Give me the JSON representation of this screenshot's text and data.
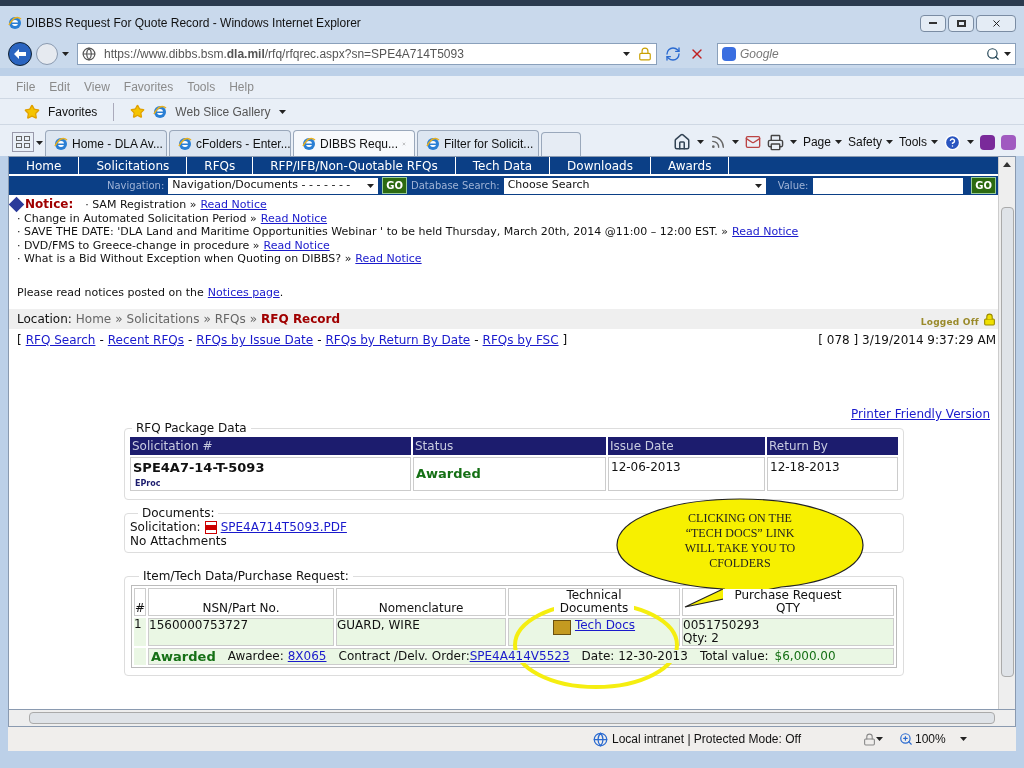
{
  "window": {
    "title": "DIBBS Request For Quote Record - Windows Internet Explorer"
  },
  "address": {
    "url": "https://www.dibbs.bsm.**dla.mil**/rfq/rfqrec.aspx?sn=SPE4A714T5093"
  },
  "search": {
    "placeholder": "Google"
  },
  "menu": [
    "File",
    "Edit",
    "View",
    "Favorites",
    "Tools",
    "Help"
  ],
  "favorites_bar": {
    "favorites": "Favorites",
    "gallery": "Web Slice Gallery"
  },
  "tabs": [
    {
      "label": "Home - DLA Av...",
      "selected": false
    },
    {
      "label": "cFolders - Enter...",
      "selected": false
    },
    {
      "label": "DIBBS Requ...",
      "selected": true
    },
    {
      "label": "Filter for Solicit...",
      "selected": false
    }
  ],
  "command_bar": [
    "Page",
    "Safety",
    "Tools"
  ],
  "site_nav": [
    "Home",
    "Solicitations",
    "RFQs",
    "RFP/IFB/Non-Quotable RFQs",
    "Tech Data",
    "Downloads",
    "Awards"
  ],
  "navigation": {
    "label": "Navigation:",
    "value": "Navigation/Documents - - - - - - -",
    "go": "GO"
  },
  "database_search": {
    "label": "Database Search:",
    "value": "Choose Search",
    "value_label": "Value:",
    "go": "GO"
  },
  "notice": {
    "label": "Notice:",
    "items": [
      {
        "text": "· SAM Registration »",
        "link": "Read Notice"
      },
      {
        "text": "· Change in Automated Solicitation Period »",
        "link": "Read Notice"
      },
      {
        "text": "· SAVE THE DATE: 'DLA Land and Maritime Opportunities Webinar ' to be held Thursday, March 20th, 2014 @11:00 – 12:00 EST. »",
        "link": "Read Notice"
      },
      {
        "text": "· DVD/FMS to Greece-change in procedure »",
        "link": "Read Notice"
      },
      {
        "text": "· What is a Bid Without Exception when Quoting on DIBBS? »",
        "link": "Read Notice"
      }
    ]
  },
  "notices_page": {
    "text": "Please read notices posted on the",
    "link": "Notices page",
    "end": "."
  },
  "location": {
    "label": "Location:",
    "crumbs": [
      {
        "label": "Home",
        "separator": "»"
      },
      {
        "label": "Solicitations",
        "separator": "»"
      },
      {
        "label": "RFQs",
        "separator": "»"
      }
    ],
    "current": "RFQ Record"
  },
  "logged_off": "Logged Off",
  "quick_links": {
    "open": "[",
    "items": [
      {
        "label": "RFQ Search"
      },
      {
        "separator": "-",
        "label": "Recent RFQs"
      },
      {
        "separator": "-",
        "label": "RFQs by Issue Date"
      },
      {
        "separator": "-",
        "label": "RFQs by Return By Date"
      },
      {
        "separator": "-",
        "label": "RFQs by FSC"
      }
    ],
    "close": "]"
  },
  "timestamp": "[ 078 ] 3/19/2014 9:37:29 AM",
  "printer_friendly": "Printer Friendly Version",
  "rfq_package": {
    "legend": "RFQ Package Data",
    "columns": [
      "Solicitation #",
      "Status",
      "Issue Date",
      "Return By"
    ],
    "solicitation": "SPE4A7-14-T-5093",
    "tag": "EProc",
    "status": "Awarded",
    "issue_date": "12-06-2013",
    "return_by": "12-18-2013"
  },
  "documents": {
    "legend": "Documents:",
    "solicitation_label": "Solicitation:",
    "file": "SPE4A714T5093.PDF",
    "attachments": "No Attachments"
  },
  "items": {
    "legend": "Item/Tech Data/Purchase Request:",
    "columns": [
      "#",
      "NSN/Part No.",
      "Nomenclature",
      "Technical Documents",
      "Purchase Request QTY"
    ],
    "rows": [
      {
        "num": "1",
        "nsn": "1560000753727",
        "nomenclature": "GUARD, WIRE",
        "tech_docs": "Tech Docs",
        "pr": "0051750293",
        "qty": "Qty: 2",
        "status": "Awarded",
        "awardee_label": "Awardee:",
        "awardee": "8X065",
        "contract_label": "Contract /Delv. Order:",
        "contract": "SPE4A414V5523",
        "date": "Date: 12-30-2013",
        "total_label": "Total value:",
        "total": "$6,000.00"
      }
    ]
  },
  "callout": {
    "text": "CLICKING ON THE “TECH DOCS” LINK WILL TAKE YOU TO CFOLDERS"
  },
  "status_bar": {
    "zone": "Local intranet | Protected Mode: Off",
    "zoom": "100%"
  }
}
